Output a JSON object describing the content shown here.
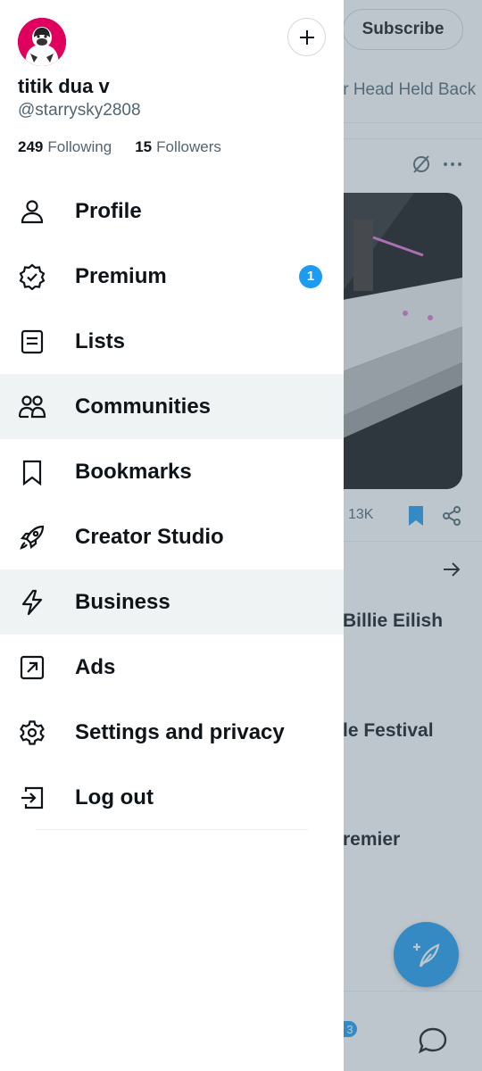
{
  "background": {
    "subscribe_label": "Subscribe",
    "headline": "ir Head Held Back",
    "views": "13K",
    "trends": [
      "Billie Eilish",
      "le Festival",
      "remier"
    ],
    "notif_badge": "3",
    "icons": [
      "grok-icon",
      "more-icon",
      "bookmark-filled-icon",
      "share-icon",
      "arrow-right-icon",
      "compose-post-icon",
      "messages-icon"
    ]
  },
  "profile": {
    "display_name": "titik dua v",
    "handle": "@starrysky2808",
    "following_count": "249",
    "following_label": "Following",
    "followers_count": "15",
    "followers_label": "Followers",
    "avatar_icon": "avatar-gorilla-image",
    "add_account_icon": "plus-icon"
  },
  "menu": {
    "items": [
      {
        "label": "Profile",
        "icon": "person-icon"
      },
      {
        "label": "Premium",
        "icon": "verified-badge-icon",
        "badge": "1"
      },
      {
        "label": "Lists",
        "icon": "list-icon"
      },
      {
        "label": "Communities",
        "icon": "communities-icon",
        "active": true
      },
      {
        "label": "Bookmarks",
        "icon": "bookmark-icon"
      },
      {
        "label": "Creator Studio",
        "icon": "rocket-icon"
      },
      {
        "label": "Business",
        "icon": "lightning-icon",
        "active": true
      },
      {
        "label": "Ads",
        "icon": "external-arrow-icon"
      },
      {
        "label": "Settings and privacy",
        "icon": "gear-icon"
      },
      {
        "label": "Log out",
        "icon": "logout-icon"
      }
    ]
  },
  "colors": {
    "accent": "#1d9bf0",
    "text": "#0f1419",
    "secondary_text": "#536471",
    "active_row": "#eff3f4",
    "avatar_bg": "#e0005e"
  }
}
